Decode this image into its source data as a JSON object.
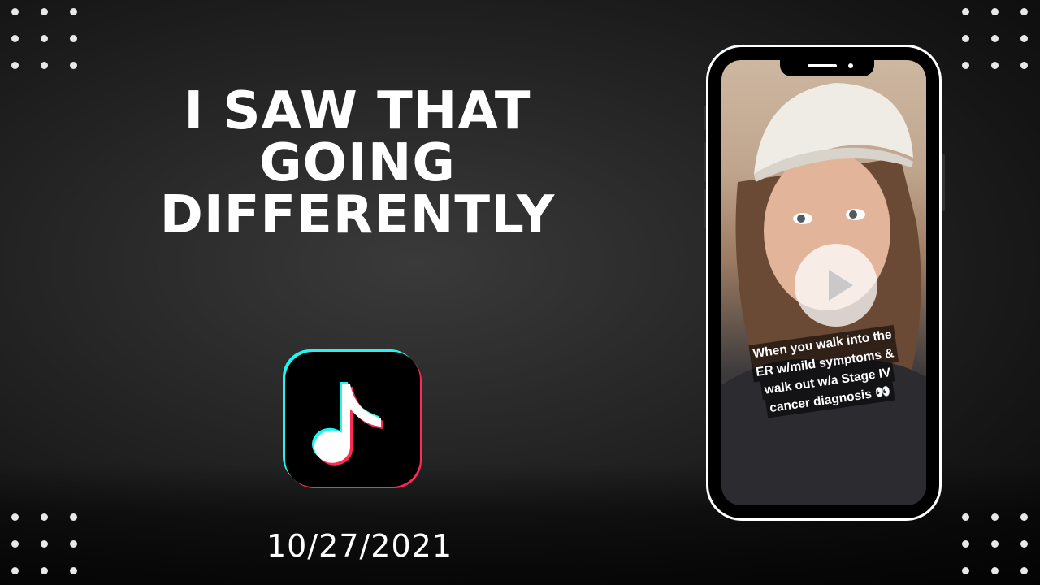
{
  "headline": {
    "line1": "I SAW THAT",
    "line2": "GOING",
    "line3": "DIFFERENTLY"
  },
  "date": "10/27/2021",
  "app_icon": {
    "name": "tiktok-icon",
    "colors": {
      "cyan": "#25f4ee",
      "red": "#fe2c55",
      "tile": "#000000"
    }
  },
  "video": {
    "caption_lines": [
      "When you walk into the",
      "ER w/mild symptoms &",
      "walk out w/a Stage IV",
      "cancer diagnosis 👀"
    ],
    "play_icon": "play-icon"
  },
  "colors": {
    "text": "#ffffff",
    "background": "#1a1a1a",
    "dots": "#e8e8e8"
  }
}
